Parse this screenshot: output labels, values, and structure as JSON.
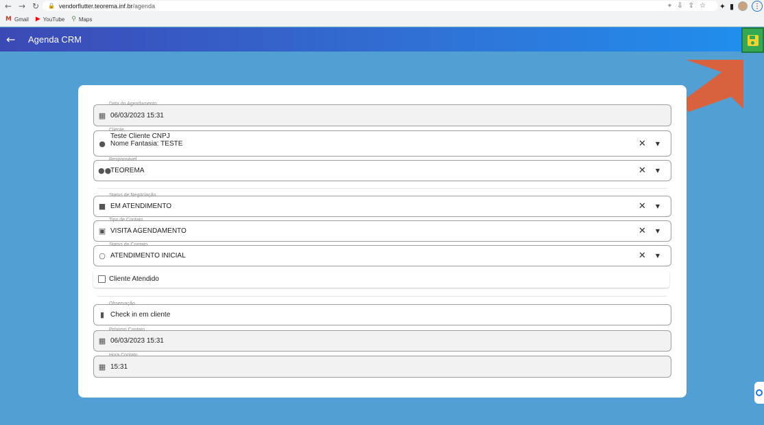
{
  "browser": {
    "url_host": "vendorflutter.teorema.inf.br",
    "url_path": "/agenda",
    "bookmarks": [
      {
        "label": "Gmail",
        "icon": "gmail-icon"
      },
      {
        "label": "YouTube",
        "icon": "youtube-icon"
      },
      {
        "label": "Maps",
        "icon": "maps-icon"
      }
    ]
  },
  "appbar": {
    "title": "Agenda CRM"
  },
  "form": {
    "data_agendamento": {
      "label": "Data do Agendamento",
      "value": "06/03/2023 15:31"
    },
    "cliente": {
      "label": "Cliente",
      "line1": "Teste Cliente CNPJ",
      "line2": "Nome Fantasia:  TESTE"
    },
    "responsavel": {
      "label": "Responsável",
      "value": "TEOREMA"
    },
    "status_negociacao": {
      "label": "Status de Negociação",
      "value": "EM ATENDIMENTO"
    },
    "tipo_contato": {
      "label": "Tipo de Contato",
      "value": "VISITA AGENDAMENTO"
    },
    "status_contato": {
      "label": "Status do Contato",
      "value": "ATENDIMENTO INICIAL"
    },
    "cliente_atendido": {
      "label": "Cliente Atendido",
      "checked": false
    },
    "observacao": {
      "label": "Observação",
      "value": "Check in em cliente"
    },
    "proximo_contato": {
      "label": "Próximo Contato",
      "value": "06/03/2023 15:31"
    },
    "hora_contato": {
      "label": "Hora Contato",
      "value": "15:31"
    }
  },
  "colors": {
    "background": "#52a0d3",
    "appbar_start": "#3c49b5",
    "appbar_end": "#1f90ef",
    "save_button": "#34a853",
    "save_icon": "#f6d32d",
    "annotation_arrow": "#e0623f"
  }
}
